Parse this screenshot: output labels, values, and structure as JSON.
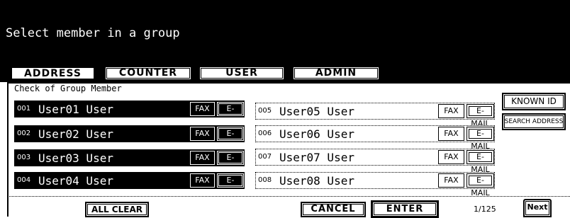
{
  "screen": {
    "title": "Select member in a group"
  },
  "tabs": [
    {
      "label": "ADDRESS",
      "active": true
    },
    {
      "label": "COUNTER",
      "active": false
    },
    {
      "label": "USER",
      "active": false
    },
    {
      "label": "ADMIN",
      "active": false
    }
  ],
  "section": {
    "label": "Check of Group Member"
  },
  "members": [
    {
      "num": "001",
      "name": "User01 User",
      "selected": true,
      "fax": "FAX",
      "email": "E-MAIL"
    },
    {
      "num": "002",
      "name": "User02 User",
      "selected": true,
      "fax": "FAX",
      "email": "E-MAIL"
    },
    {
      "num": "003",
      "name": "User03 User",
      "selected": true,
      "fax": "FAX",
      "email": "E-MAIL"
    },
    {
      "num": "004",
      "name": "User04 User",
      "selected": true,
      "fax": "FAX",
      "email": "E-MAIL"
    },
    {
      "num": "005",
      "name": "User05 User",
      "selected": false,
      "fax": "FAX",
      "email": "E-MAIL"
    },
    {
      "num": "006",
      "name": "User06 User",
      "selected": false,
      "fax": "FAX",
      "email": "E-MAIL"
    },
    {
      "num": "007",
      "name": "User07 User",
      "selected": false,
      "fax": "FAX",
      "email": "E-MAIL"
    },
    {
      "num": "008",
      "name": "User08 User",
      "selected": false,
      "fax": "FAX",
      "email": "E-MAIL"
    }
  ],
  "side_buttons": {
    "known_id": "KNOWN ID",
    "search_address": "SEARCH ADDRESS"
  },
  "footer": {
    "all_clear": "ALL CLEAR",
    "cancel": "CANCEL",
    "enter": "ENTER",
    "page_indicator": "1/125",
    "next": "Next"
  }
}
